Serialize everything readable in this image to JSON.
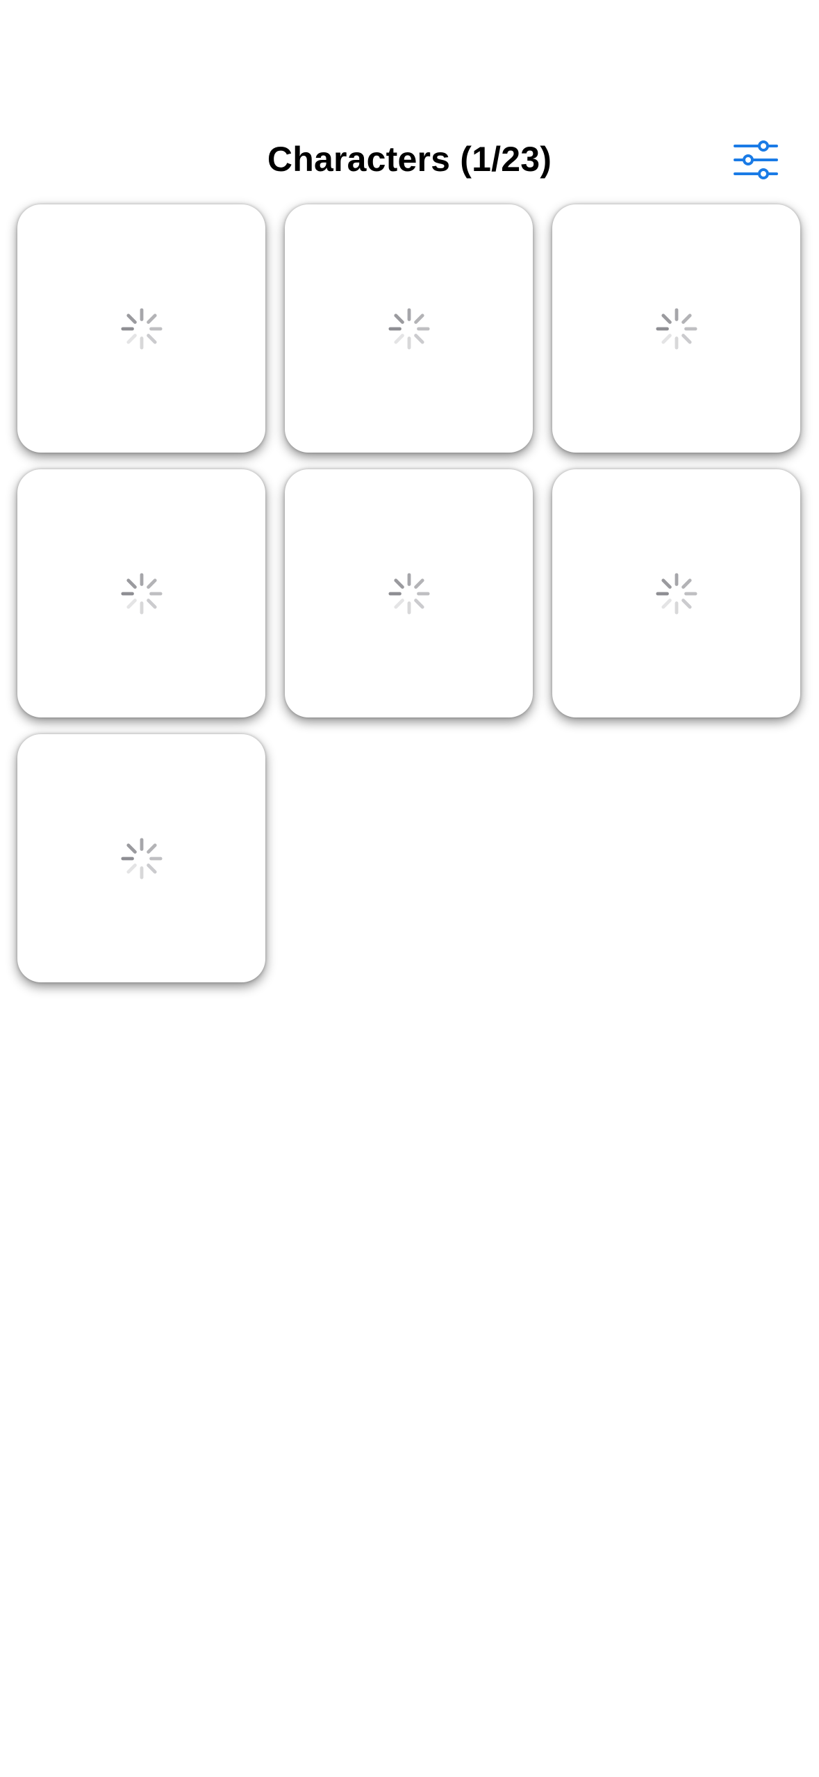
{
  "header": {
    "title": "Characters (1/23)",
    "filter_icon": "sliders-filter-icon",
    "accent_color": "#1a7be6"
  },
  "grid": {
    "cards": [
      {
        "status": "loading",
        "icon": "activity-spinner-icon"
      },
      {
        "status": "loading",
        "icon": "activity-spinner-icon"
      },
      {
        "status": "loading",
        "icon": "activity-spinner-icon"
      },
      {
        "status": "loading",
        "icon": "activity-spinner-icon"
      },
      {
        "status": "loading",
        "icon": "activity-spinner-icon"
      },
      {
        "status": "loading",
        "icon": "activity-spinner-icon"
      },
      {
        "status": "loading",
        "icon": "activity-spinner-icon"
      }
    ]
  }
}
